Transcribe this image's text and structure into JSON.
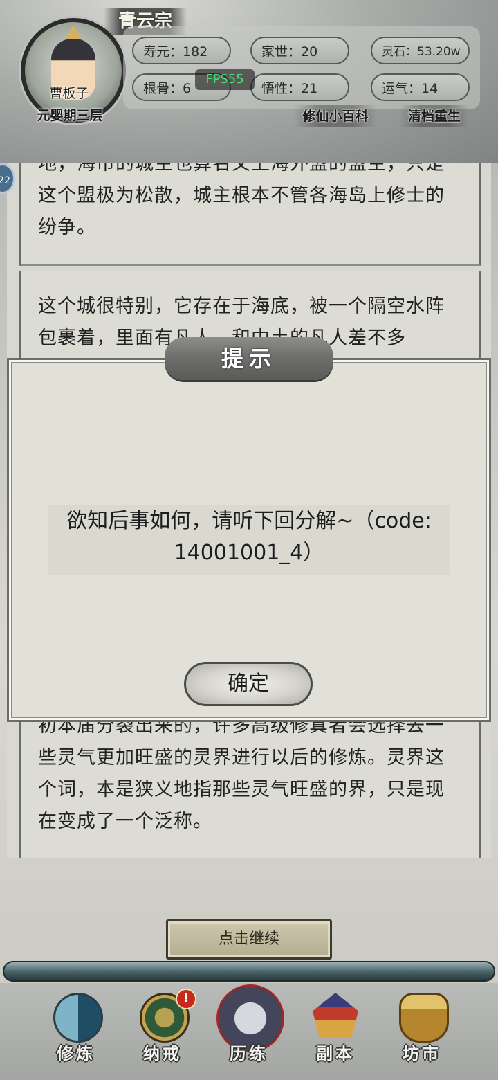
{
  "header": {
    "sect_name": "青云宗",
    "player_name": "曹板子",
    "realm": "元婴期三层",
    "fps": "FPS55",
    "stats": {
      "lifespan": "寿元：182",
      "family": "家世：20",
      "spirit_stones": "灵石：53.20w",
      "root_bone": "根骨：6",
      "comprehension": "悟性：21",
      "luck": "运气：14"
    },
    "links": {
      "encyclopedia": "修仙小百科",
      "restart": "清档重生"
    }
  },
  "story": {
    "paragraph_1": "地，海市的城主也算名义上海外盟的盟主，只是这个盟极为松散，城主根本不管各海岛上修士的纷争。",
    "paragraph_2": "这个城很特别，它存在于海底，被一个隔空水阵包裹着，里面有凡人，和中土的凡人差不多",
    "paragraph_3": "初本届分裂出来的，许多高级修真者会选择去一些灵气更加旺盛的灵界进行以后的修炼。灵界这个词，本是狭义地指那些灵气旺盛的界，只是现在变成了一个泛称。"
  },
  "dialog": {
    "title": "提示",
    "message": "欲知后事如何，请听下回分解~（code: 14001001_4）",
    "ok_label": "确定"
  },
  "continue_label": "点击继续",
  "bottom_nav": [
    {
      "label": "修炼",
      "icon": "yin-yang-icon"
    },
    {
      "label": "纳戒",
      "icon": "storage-ring-icon",
      "badge": "!"
    },
    {
      "label": "历练",
      "icon": "mountain-cloud-icon"
    },
    {
      "label": "副本",
      "icon": "pagoda-icon"
    },
    {
      "label": "坊市",
      "icon": "cauldron-icon"
    }
  ],
  "colors": {
    "fps_green": "#47e072",
    "badge_red": "#c8281e",
    "dialog_bg": "#e2e1d8"
  }
}
